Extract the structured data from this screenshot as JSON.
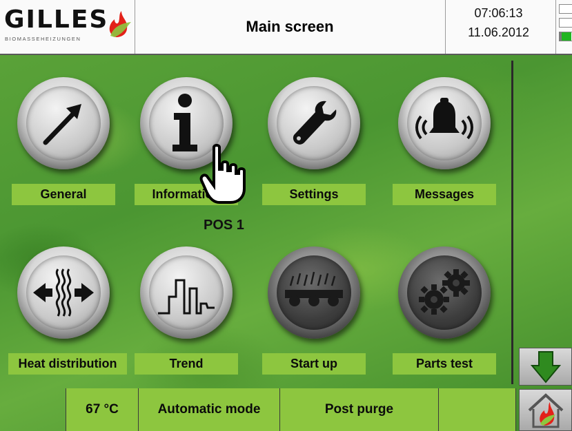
{
  "header": {
    "logo_text": "GILLES",
    "logo_sub": "BIOMASSEHEIZUNGEN",
    "title": "Main screen",
    "time": "07:06:13",
    "date": "11.06.2012"
  },
  "tiles": [
    {
      "label": "General",
      "icon": "arrow-up-right-icon"
    },
    {
      "label": "Information",
      "icon": "info-icon"
    },
    {
      "label": "Settings",
      "icon": "wrench-icon"
    },
    {
      "label": "Messages",
      "icon": "bell-icon"
    },
    {
      "label": "Heat distribution",
      "icon": "heat-exchange-icon"
    },
    {
      "label": "Trend",
      "icon": "trend-icon"
    },
    {
      "label": "Start up",
      "icon": "fuel-conveyor-icon"
    },
    {
      "label": "Parts test",
      "icon": "gears-icon"
    }
  ],
  "overlay": {
    "pos_label": "POS 1",
    "cursor_icon": "hand-pointer-icon"
  },
  "status": {
    "temperature": "67 °C",
    "mode": "Automatic mode",
    "phase": "Post purge",
    "extra": ""
  },
  "side": {
    "down_icon": "arrow-down-icon",
    "home_icon": "home-flame-icon"
  },
  "colors": {
    "label_green": "#8dc63f",
    "indicator_green": "#22b522",
    "flame_red": "#e32119"
  }
}
